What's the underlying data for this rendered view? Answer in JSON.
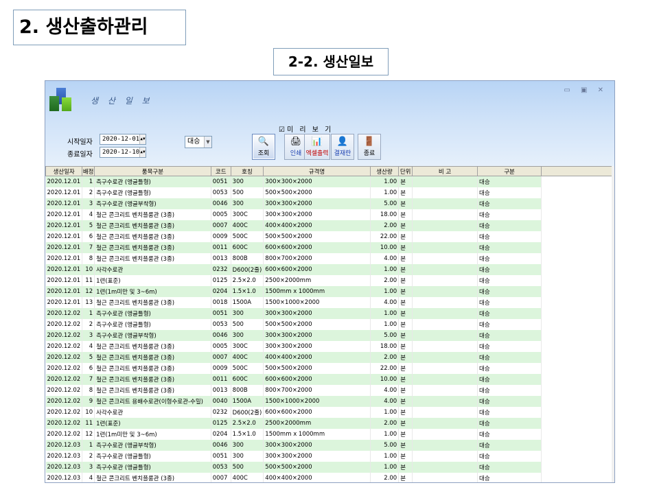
{
  "slide": {
    "title": "2. 생산출하관리",
    "subtitle": "2-2. 생산일보"
  },
  "window": {
    "app_title": "생 산 일 보",
    "controls": "▭ ▣ ✕"
  },
  "filters": {
    "start_label": "시작일자",
    "start_value": "2020-12-01",
    "end_label": "종료일자",
    "end_value": "2020-12-10",
    "type_value": "대승",
    "preview_label": "☑미 리 보 기"
  },
  "toolbar": [
    {
      "name": "search-button",
      "icon": "🔍",
      "label": "조회",
      "color": "#000000"
    },
    {
      "name": "print-button",
      "icon": "🖨",
      "label": "인쇄",
      "color": "#1a3fb0"
    },
    {
      "name": "excel-button",
      "icon": "📊",
      "label": "엑셀출력",
      "color": "#c00000"
    },
    {
      "name": "approval-button",
      "icon": "👤",
      "label": "결재란",
      "color": "#1a3fb0"
    },
    {
      "name": "exit-button",
      "icon": "🚪",
      "label": "종료",
      "color": "#000000"
    }
  ],
  "columns": [
    "생산일자",
    "배정",
    "품목구분",
    "코드",
    "호칭",
    "규격명",
    "생산량",
    "단위",
    "비 고",
    "구분"
  ],
  "rows": [
    [
      "2020.12.01",
      "1",
      "측구수로관 (앵글틀형)",
      "0051",
      "300",
      "300×300×2000",
      "1.00",
      "본",
      "",
      "대승"
    ],
    [
      "2020.12.01",
      "2",
      "측구수로관 (앵글틀형)",
      "0053",
      "500",
      "500×500×2000",
      "1.00",
      "본",
      "",
      "대승"
    ],
    [
      "2020.12.01",
      "3",
      "측구수로관 (앵글부착형)",
      "0046",
      "300",
      "300×300×2000",
      "5.00",
      "본",
      "",
      "대승"
    ],
    [
      "2020.12.01",
      "4",
      "철근 콘크리트 벤치플룸관 (3종)",
      "0005",
      "300C",
      "300×300×2000",
      "18.00",
      "본",
      "",
      "대승"
    ],
    [
      "2020.12.01",
      "5",
      "철근 콘크리트 벤치플룸관 (3종)",
      "0007",
      "400C",
      "400×400×2000",
      "2.00",
      "본",
      "",
      "대승"
    ],
    [
      "2020.12.01",
      "6",
      "철근 콘크리트 벤치플룸관 (3종)",
      "0009",
      "500C",
      "500×500×2000",
      "22.00",
      "본",
      "",
      "대승"
    ],
    [
      "2020.12.01",
      "7",
      "철근 콘크리트 벤치플룸관 (3종)",
      "0011",
      "600C",
      "600×600×2000",
      "10.00",
      "본",
      "",
      "대승"
    ],
    [
      "2020.12.01",
      "8",
      "철근 콘크리트 벤치플룸관 (3종)",
      "0013",
      "800B",
      "800×700×2000",
      "4.00",
      "본",
      "",
      "대승"
    ],
    [
      "2020.12.01",
      "10",
      "사각수로관",
      "0232",
      "D600(2줄)",
      "600×600×2000",
      "1.00",
      "본",
      "",
      "대승"
    ],
    [
      "2020.12.01",
      "11",
      "1련(표준)",
      "0125",
      "2.5×2.0",
      "2500×2000mm",
      "2.00",
      "본",
      "",
      "대승"
    ],
    [
      "2020.12.01",
      "12",
      "1련(1m미만 및 3~6m)",
      "0204",
      "1.5×1.0",
      "1500mm x 1000mm",
      "1.00",
      "본",
      "",
      "대승"
    ],
    [
      "2020.12.01",
      "13",
      "철근 콘크리트 벤치플룸관 (3종)",
      "0018",
      "1500A",
      "1500×1000×2000",
      "4.00",
      "본",
      "",
      "대승"
    ],
    [
      "2020.12.02",
      "1",
      "측구수로관 (앵글틀형)",
      "0051",
      "300",
      "300×300×2000",
      "1.00",
      "본",
      "",
      "대승"
    ],
    [
      "2020.12.02",
      "2",
      "측구수로관 (앵글틀형)",
      "0053",
      "500",
      "500×500×2000",
      "1.00",
      "본",
      "",
      "대승"
    ],
    [
      "2020.12.02",
      "3",
      "측구수로관 (앵글부착형)",
      "0046",
      "300",
      "300×300×2000",
      "5.00",
      "본",
      "",
      "대승"
    ],
    [
      "2020.12.02",
      "4",
      "철근 콘크리트 벤치플룸관 (3종)",
      "0005",
      "300C",
      "300×300×2000",
      "18.00",
      "본",
      "",
      "대승"
    ],
    [
      "2020.12.02",
      "5",
      "철근 콘크리트 벤치플룸관 (3종)",
      "0007",
      "400C",
      "400×400×2000",
      "2.00",
      "본",
      "",
      "대승"
    ],
    [
      "2020.12.02",
      "6",
      "철근 콘크리트 벤치플룸관 (3종)",
      "0009",
      "500C",
      "500×500×2000",
      "22.00",
      "본",
      "",
      "대승"
    ],
    [
      "2020.12.02",
      "7",
      "철근 콘크리트 벤치플룸관 (3종)",
      "0011",
      "600C",
      "600×600×2000",
      "10.00",
      "본",
      "",
      "대승"
    ],
    [
      "2020.12.02",
      "8",
      "철근 콘크리트 벤치플룸관 (3종)",
      "0013",
      "800B",
      "800×700×2000",
      "4.00",
      "본",
      "",
      "대승"
    ],
    [
      "2020.12.02",
      "9",
      "철근 콘크리트 용배수로관(이형수로관-수밀)",
      "0040",
      "1500A",
      "1500×1000×2000",
      "4.00",
      "본",
      "",
      "대승"
    ],
    [
      "2020.12.02",
      "10",
      "사각수로관",
      "0232",
      "D600(2줄)",
      "600×600×2000",
      "1.00",
      "본",
      "",
      "대승"
    ],
    [
      "2020.12.02",
      "11",
      "1련(표준)",
      "0125",
      "2.5×2.0",
      "2500×2000mm",
      "2.00",
      "본",
      "",
      "대승"
    ],
    [
      "2020.12.02",
      "12",
      "1련(1m미만 및 3~6m)",
      "0204",
      "1.5×1.0",
      "1500mm x 1000mm",
      "1.00",
      "본",
      "",
      "대승"
    ],
    [
      "2020.12.03",
      "1",
      "측구수로관 (앵글부착형)",
      "0046",
      "300",
      "300×300×2000",
      "5.00",
      "본",
      "",
      "대승"
    ],
    [
      "2020.12.03",
      "2",
      "측구수로관 (앵글틀형)",
      "0051",
      "300",
      "300×300×2000",
      "1.00",
      "본",
      "",
      "대승"
    ],
    [
      "2020.12.03",
      "3",
      "측구수로관 (앵글틀형)",
      "0053",
      "500",
      "500×500×2000",
      "1.00",
      "본",
      "",
      "대승"
    ],
    [
      "2020.12.03",
      "4",
      "철근 콘크리트 벤치플룸관 (3종)",
      "0007",
      "400C",
      "400×400×2000",
      "2.00",
      "본",
      "",
      "대승"
    ]
  ]
}
